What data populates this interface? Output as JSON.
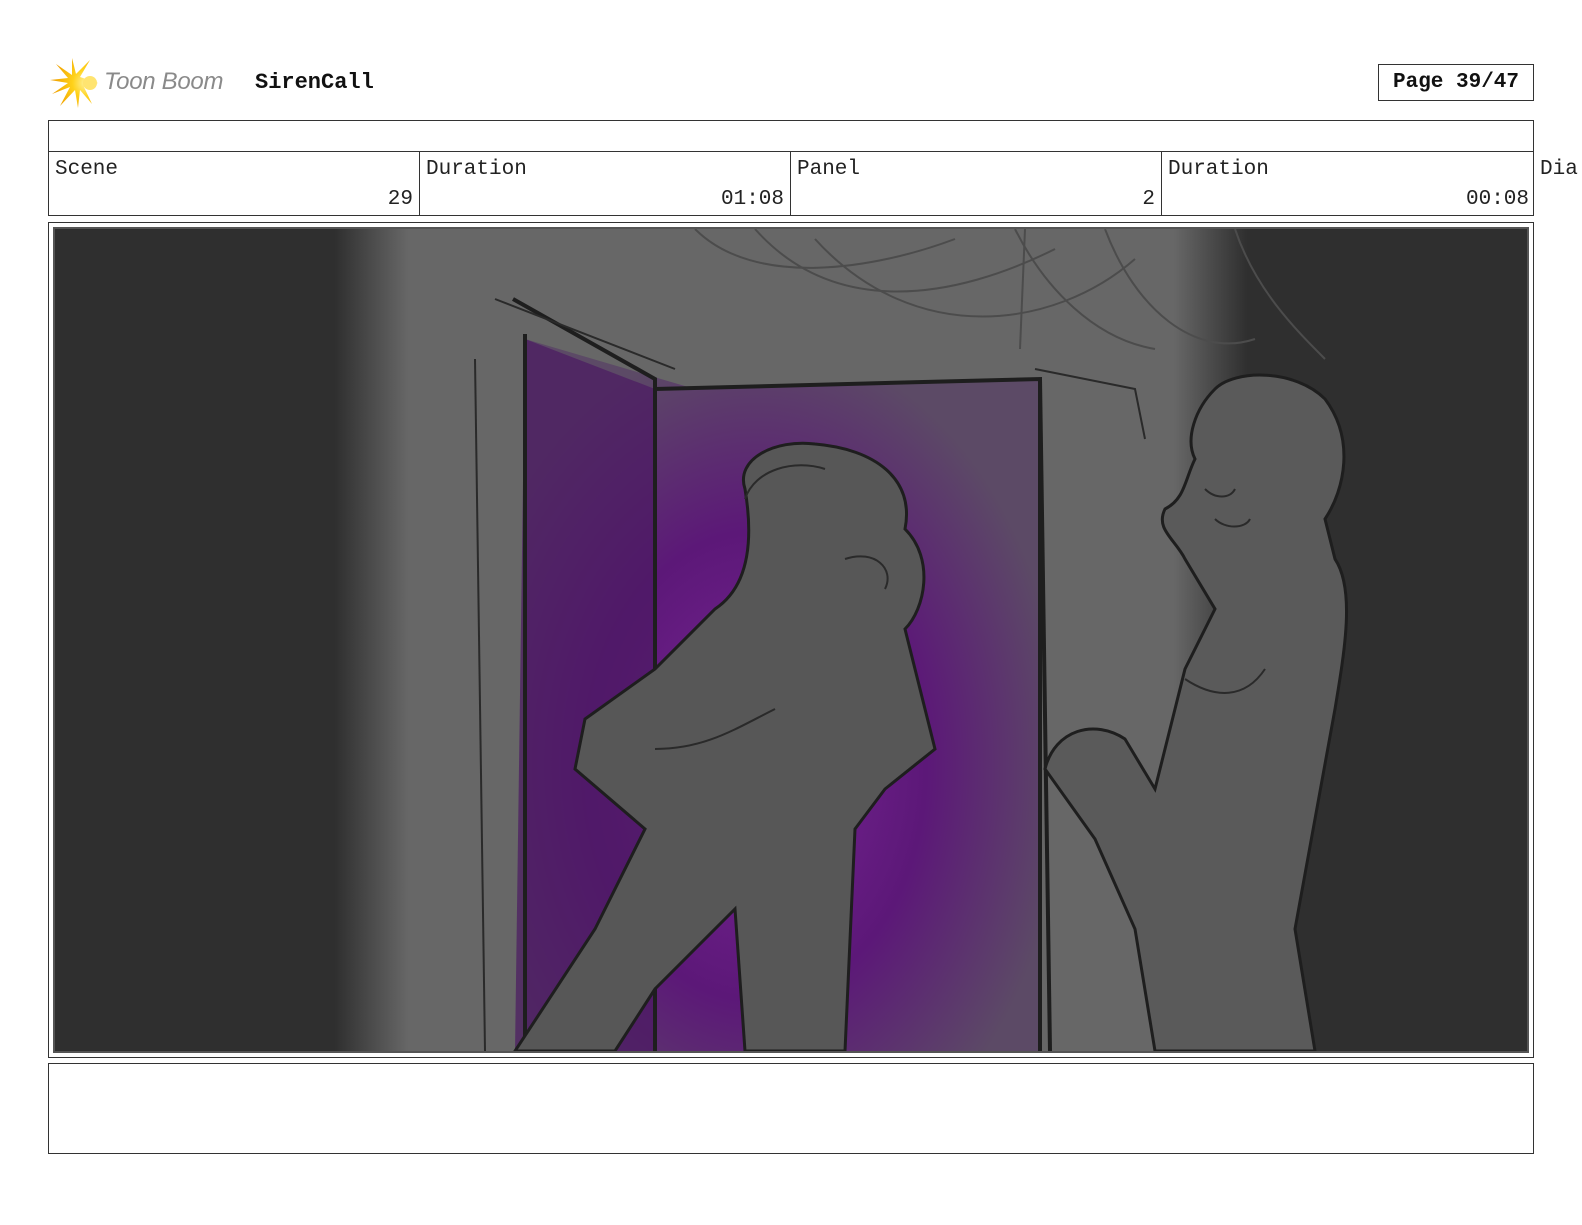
{
  "header": {
    "logo_text": "Toon Boom",
    "project_title": "SirenCall",
    "page_label": "Page 39/47"
  },
  "info": {
    "scene_label": "Scene",
    "scene_value": "29",
    "scene_duration_label": "Duration",
    "scene_duration_value": "01:08",
    "panel_label": "Panel",
    "panel_value": "2",
    "panel_duration_label": "Duration",
    "panel_duration_value": "00:08",
    "overflow_label": "Dia"
  },
  "panel_image": {
    "description_icon": "storyboard-sketch",
    "door_light_color": "#6a1a8a"
  },
  "dialogue": {
    "text": ""
  }
}
